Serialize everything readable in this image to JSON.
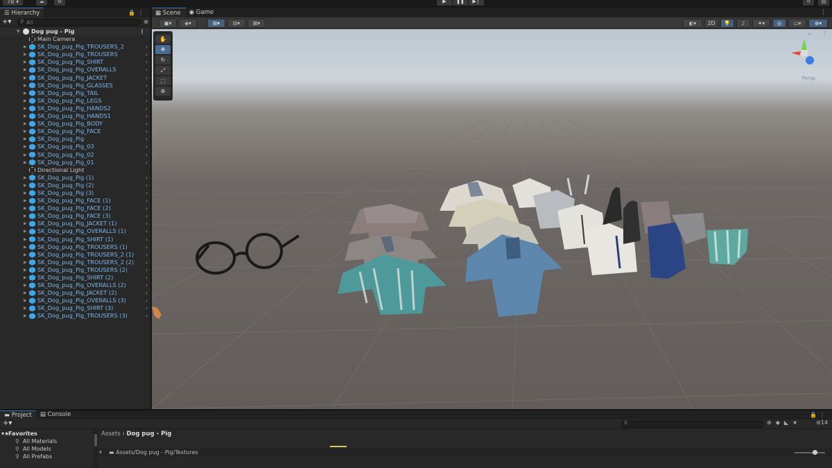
{
  "toolbar": {
    "account_label": "7B ▾",
    "play_icon": "▶",
    "pause_icon": "❚❚",
    "step_icon": "▶❘"
  },
  "hierarchy": {
    "tab_label": "Hierarchy",
    "search_placeholder": "All",
    "scene_name": "Dog pug - Pig",
    "items": [
      {
        "label": "Main Camera",
        "type": "object",
        "expandable": false
      },
      {
        "label": "SK_Dog_pug_Pig_TROUSERS_2",
        "type": "prefab",
        "expandable": true
      },
      {
        "label": "SK_Dog_pug_Pig_TROUSERS",
        "type": "prefab",
        "expandable": true
      },
      {
        "label": "SK_Dog_pug_Pig_SHIRT",
        "type": "prefab",
        "expandable": true
      },
      {
        "label": "SK_Dog_pug_Pig_OVERALLS",
        "type": "prefab",
        "expandable": true
      },
      {
        "label": "SK_Dog_pug_Pig_JACKET",
        "type": "prefab",
        "expandable": true
      },
      {
        "label": "SK_Dog_pug_Pig_GLASSES",
        "type": "prefab",
        "expandable": true
      },
      {
        "label": "SK_Dog_pug_Pig_TAIL",
        "type": "prefab",
        "expandable": true
      },
      {
        "label": "SK_Dog_pug_Pig_LEGS",
        "type": "prefab",
        "expandable": true
      },
      {
        "label": "SK_Dog_pug_Pig_HANDS2",
        "type": "prefab",
        "expandable": true
      },
      {
        "label": "SK_Dog_pug_Pig_HANDS1",
        "type": "prefab",
        "expandable": true
      },
      {
        "label": "SK_Dog_pug_Pig_BODY",
        "type": "prefab",
        "expandable": true
      },
      {
        "label": "SK_Dog_pug_Pig_FACE",
        "type": "prefab",
        "expandable": true
      },
      {
        "label": "SK_Dog_pug_Pig",
        "type": "prefab",
        "expandable": true
      },
      {
        "label": "SK_Dog_pug_Pig_03",
        "type": "prefab",
        "expandable": true
      },
      {
        "label": "SK_Dog_pug_Pig_02",
        "type": "prefab",
        "expandable": true
      },
      {
        "label": "SK_Dog_pug_Pig_01",
        "type": "prefab",
        "expandable": true
      },
      {
        "label": "Directional Light",
        "type": "object",
        "expandable": false
      },
      {
        "label": "SK_Dog_pug_Pig (1)",
        "type": "prefab",
        "expandable": true
      },
      {
        "label": "SK_Dog_pug_Pig (2)",
        "type": "prefab",
        "expandable": true
      },
      {
        "label": "SK_Dog_pug_Pig (3)",
        "type": "prefab",
        "expandable": true
      },
      {
        "label": "SK_Dog_pug_Pig_FACE (1)",
        "type": "prefab",
        "expandable": true
      },
      {
        "label": "SK_Dog_pug_Pig_FACE (2)",
        "type": "prefab",
        "expandable": true
      },
      {
        "label": "SK_Dog_pug_Pig_FACE (3)",
        "type": "prefab",
        "expandable": true
      },
      {
        "label": "SK_Dog_pug_Pig_JACKET (1)",
        "type": "prefab",
        "expandable": true
      },
      {
        "label": "SK_Dog_pug_Pig_OVERALLS (1)",
        "type": "prefab",
        "expandable": true
      },
      {
        "label": "SK_Dog_pug_Pig_SHIRT (1)",
        "type": "prefab",
        "expandable": true
      },
      {
        "label": "SK_Dog_pug_Pig_TROUSERS (1)",
        "type": "prefab",
        "expandable": true
      },
      {
        "label": "SK_Dog_pug_Pig_TROUSERS_2 (1)",
        "type": "prefab",
        "expandable": true
      },
      {
        "label": "SK_Dog_pug_Pig_TROUSERS_2 (2)",
        "type": "prefab",
        "expandable": true
      },
      {
        "label": "SK_Dog_pug_Pig_TROUSERS (2)",
        "type": "prefab",
        "expandable": true
      },
      {
        "label": "SK_Dog_pug_Pig_SHIRT (2)",
        "type": "prefab",
        "expandable": true
      },
      {
        "label": "SK_Dog_pug_Pig_OVERALLS (2)",
        "type": "prefab",
        "expandable": true
      },
      {
        "label": "SK_Dog_pug_Pig_JACKET (2)",
        "type": "prefab",
        "expandable": true
      },
      {
        "label": "SK_Dog_pug_Pig_OVERALLS (3)",
        "type": "prefab",
        "expandable": true
      },
      {
        "label": "SK_Dog_pug_Pig_SHIRT (3)",
        "type": "prefab",
        "expandable": true
      },
      {
        "label": "SK_Dog_pug_Pig_TROUSERS (3)",
        "type": "prefab",
        "expandable": true
      }
    ]
  },
  "scene_view": {
    "tabs": [
      {
        "label": "Scene",
        "active": true
      },
      {
        "label": "Game",
        "active": false
      }
    ],
    "toggle_2d_label": "2D",
    "camera_label": "Persp"
  },
  "project": {
    "tabs": [
      {
        "label": "Project",
        "active": true
      },
      {
        "label": "Console",
        "active": false
      }
    ],
    "favorites_label": "Favorites",
    "favorites": [
      "All Materials",
      "All Models",
      "All Prefabs"
    ],
    "breadcrumb_root": "Assets",
    "breadcrumb_current": "Dog pug - Pig",
    "folder_path": "Assets/Dog pug - Pig/Textures",
    "hidden_count": "14"
  },
  "colors": {
    "accent": "#3a79bb",
    "prefab_text": "#7bb8f0",
    "panel_bg": "#282828"
  }
}
